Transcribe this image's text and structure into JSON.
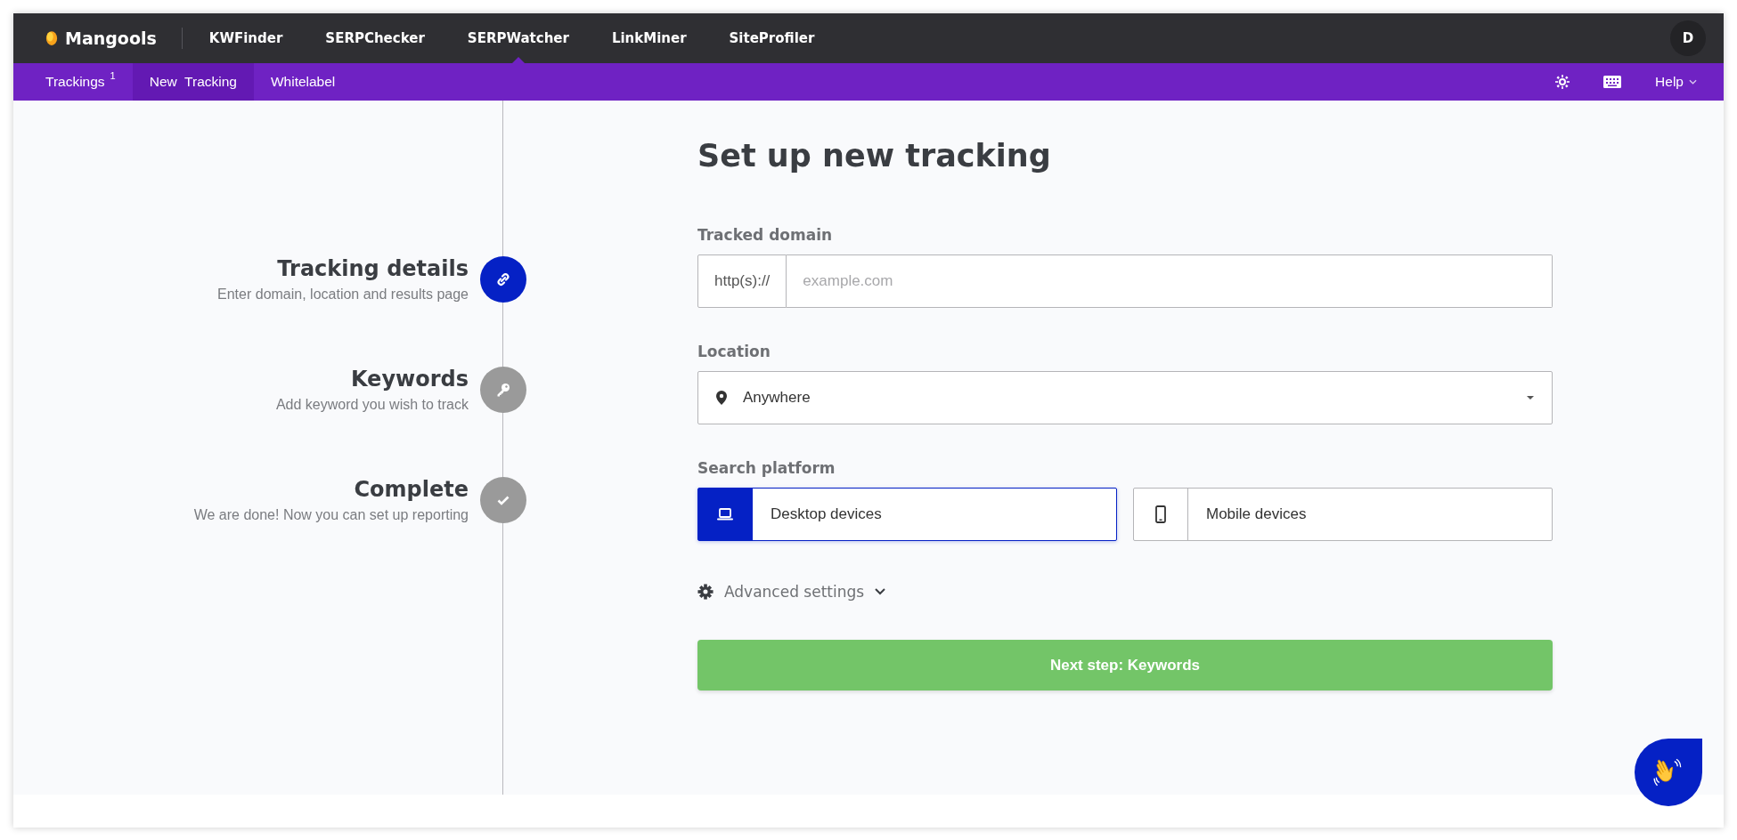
{
  "brand": {
    "name": "Mangools"
  },
  "nav": [
    {
      "label": "KWFinder",
      "selected": false
    },
    {
      "label": "SERPChecker",
      "selected": false
    },
    {
      "label": "SERPWatcher",
      "selected": true
    },
    {
      "label": "LinkMiner",
      "selected": false
    },
    {
      "label": "SiteProfiler",
      "selected": false
    }
  ],
  "avatar": {
    "initial": "D"
  },
  "subnav": [
    {
      "label": "Trackings",
      "badge": "1",
      "selected": false
    },
    {
      "label": "New  Tracking",
      "selected": true
    },
    {
      "label": "Whitelabel",
      "selected": false
    }
  ],
  "help": {
    "label": "Help"
  },
  "steps": [
    {
      "title": "Tracking details",
      "description": "Enter domain, location and results page",
      "kind": "link",
      "selected": true
    },
    {
      "title": "Keywords",
      "description": "Add keyword you wish to track",
      "kind": "key",
      "selected": false
    },
    {
      "title": "Complete",
      "description": "We are done! Now you can set up reporting",
      "kind": "check",
      "selected": false
    }
  ],
  "form": {
    "heading": "Set up new tracking",
    "domain": {
      "label": "Tracked domain",
      "prefix": "http(s)://",
      "placeholder": "example.com"
    },
    "location": {
      "label": "Location",
      "value": "Anywhere"
    },
    "platform": {
      "label": "Search platform",
      "options": [
        {
          "label": "Desktop devices",
          "kind": "desktop",
          "selected": true
        },
        {
          "label": "Mobile devices",
          "kind": "mobile",
          "selected": false
        }
      ]
    },
    "advanced": {
      "label": "Advanced settings",
      "expanded": false
    },
    "submit": {
      "label": "Next step: Keywords"
    }
  }
}
